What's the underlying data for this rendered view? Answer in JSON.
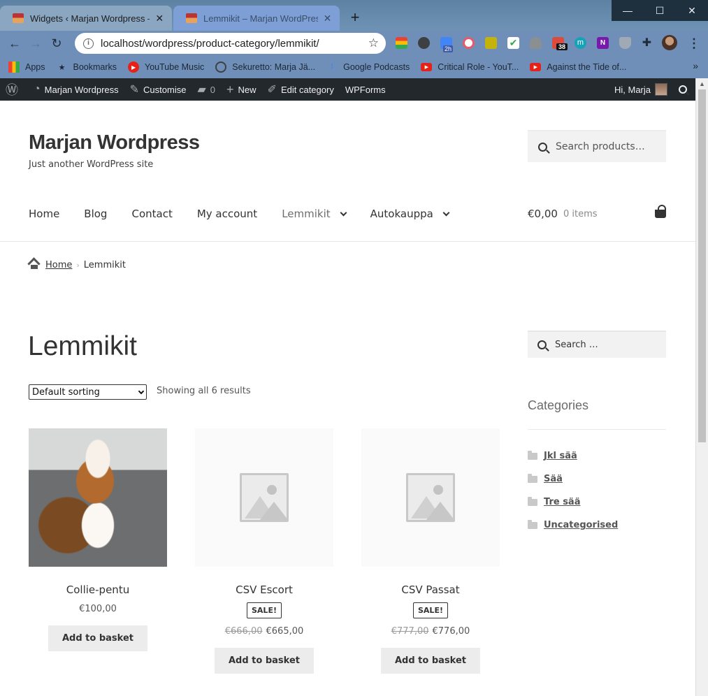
{
  "browser": {
    "tabs": [
      {
        "title": "Widgets ‹ Marjan Wordpress — W",
        "active": false
      },
      {
        "title": "Lemmikit – Marjan WordPress",
        "active": true
      }
    ],
    "url": "localhost/wordpress/product-category/lemmikit/",
    "extension_badges": {
      "calendar": "2h",
      "todoist": "38"
    },
    "bookmarks": [
      {
        "label": "Apps",
        "icon": "apps-grid-icon"
      },
      {
        "label": "Bookmarks",
        "icon": "star-icon"
      },
      {
        "label": "YouTube Music",
        "icon": "youtube-music-icon"
      },
      {
        "label": "Sekuretto: Marja Jä...",
        "icon": "globe-icon"
      },
      {
        "label": "Google Podcasts",
        "icon": "google-podcasts-icon"
      },
      {
        "label": "Critical Role - YouT...",
        "icon": "youtube-icon"
      },
      {
        "label": "Against the Tide of...",
        "icon": "youtube-icon"
      }
    ]
  },
  "adminbar": {
    "site": "Marjan Wordpress",
    "customise": "Customise",
    "comments": "0",
    "new": "New",
    "edit": "Edit category",
    "wpforms": "WPForms",
    "greeting": "Hi, Marja"
  },
  "site": {
    "title": "Marjan Wordpress",
    "tagline": "Just another WordPress site",
    "search_placeholder": "Search products…",
    "nav": [
      "Home",
      "Blog",
      "Contact",
      "My account",
      "Lemmikit",
      "Autokauppa"
    ],
    "cart_total": "€0,00",
    "cart_count": "0 items"
  },
  "breadcrumb": {
    "home": "Home",
    "current": "Lemmikit"
  },
  "page": {
    "title": "Lemmikit",
    "sort_selected": "Default sorting",
    "results": "Showing all 6 results"
  },
  "products": [
    {
      "name": "Collie-pentu",
      "price": "€100,00",
      "old_price": "",
      "sale": "",
      "button": "Add to basket"
    },
    {
      "name": "CSV Escort",
      "price": "€665,00",
      "old_price": "€666,00",
      "sale": "SALE!",
      "button": "Add to basket"
    },
    {
      "name": "CSV Passat",
      "price": "€776,00",
      "old_price": "€777,00",
      "sale": "SALE!",
      "button": "Add to basket"
    }
  ],
  "sidebar": {
    "search_placeholder": "Search …",
    "categories_title": "Categories",
    "categories": [
      "Jkl sää",
      "Sää",
      "Tre sää",
      "Uncategorised"
    ]
  }
}
